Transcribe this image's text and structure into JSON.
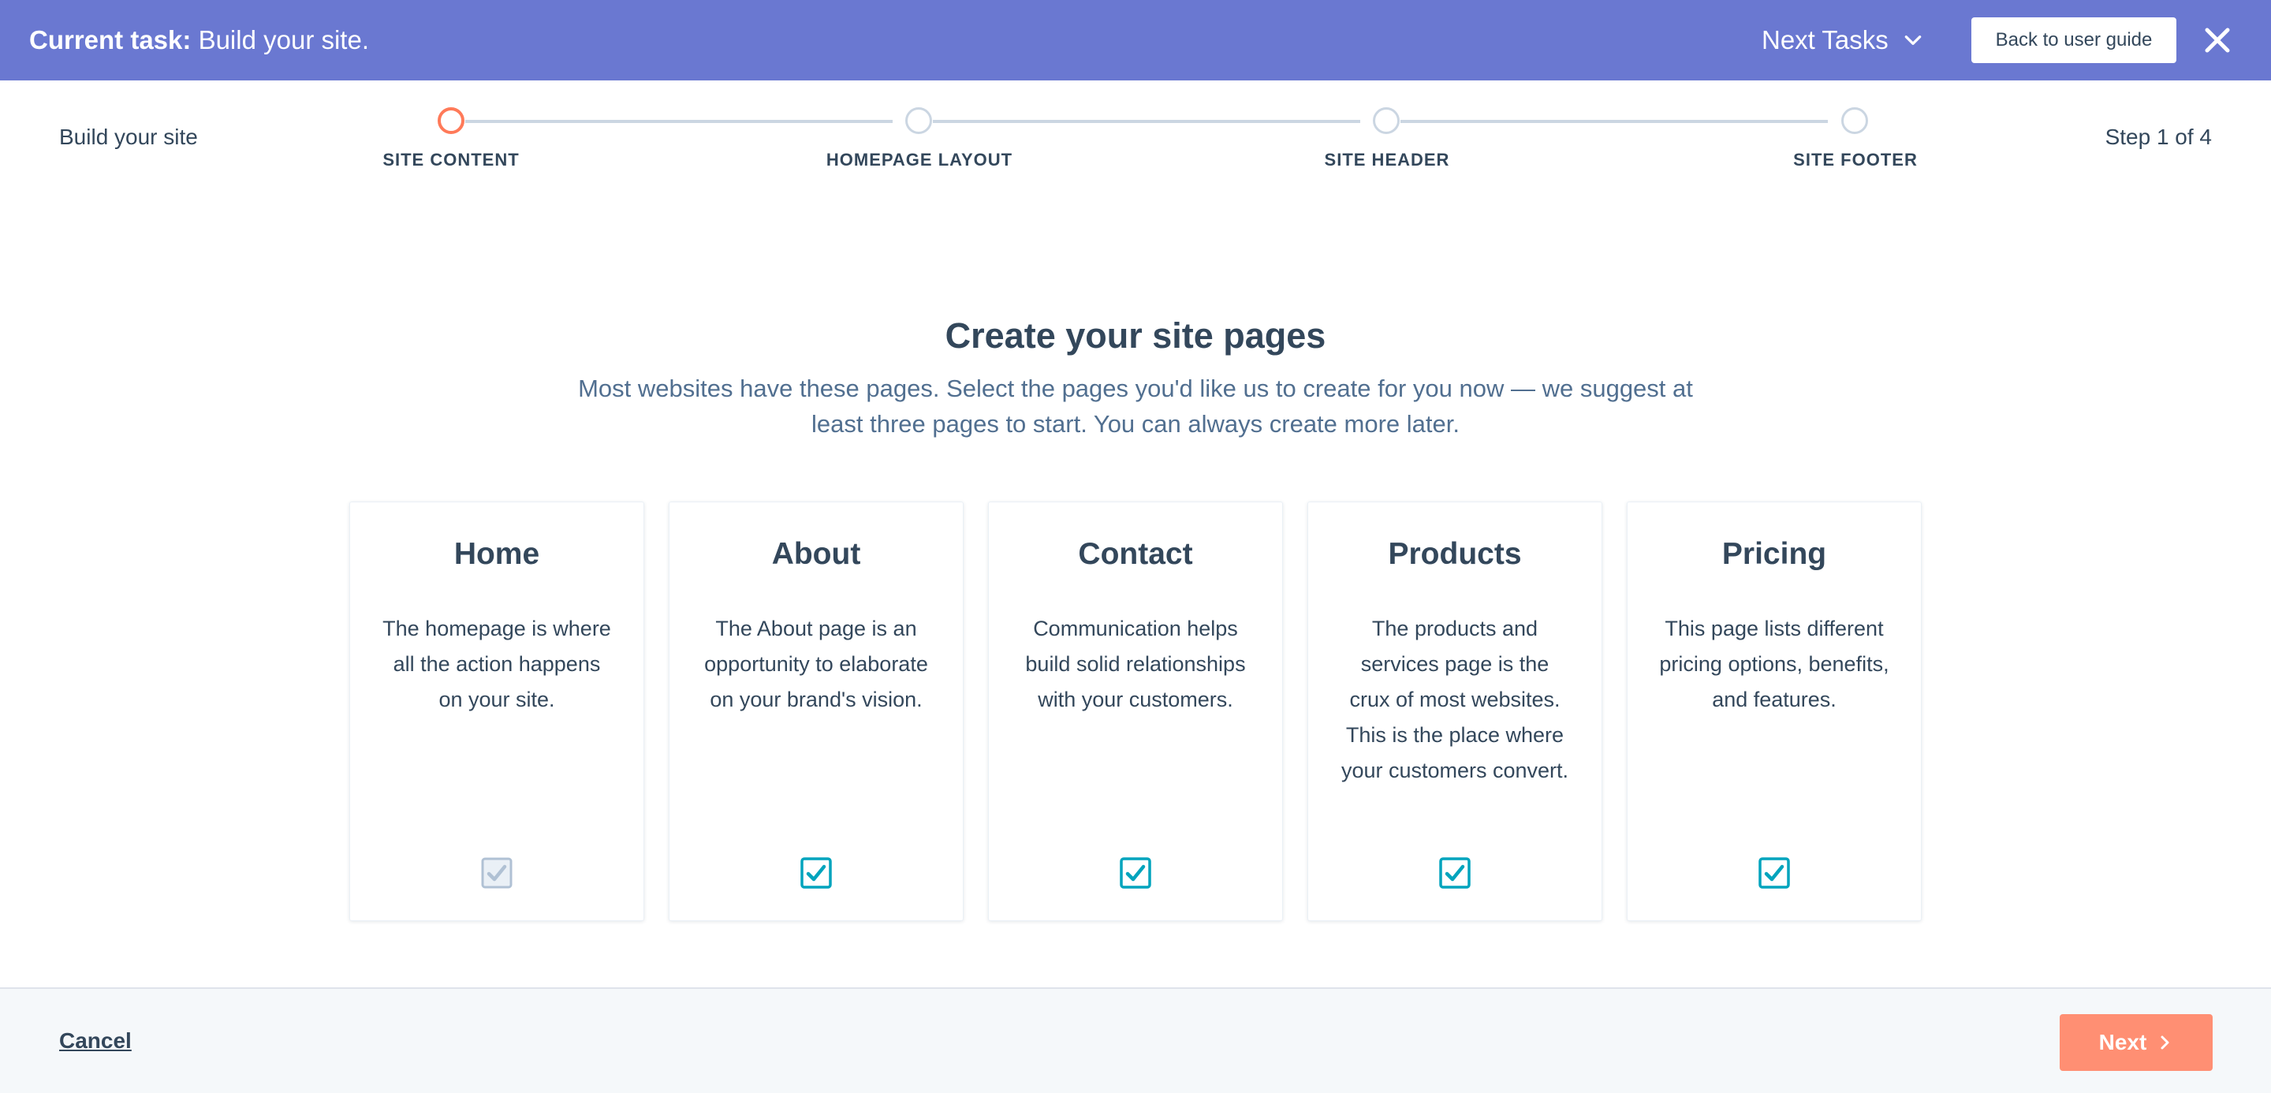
{
  "topbar": {
    "task_prefix": "Current task:",
    "task_name": "Build your site.",
    "next_tasks_label": "Next Tasks",
    "guide_button": "Back to user guide"
  },
  "stepper": {
    "title": "Build your site",
    "progress": "Step 1 of 4",
    "steps": [
      {
        "label": "SITE CONTENT",
        "active": true
      },
      {
        "label": "HOMEPAGE LAYOUT",
        "active": false
      },
      {
        "label": "SITE HEADER",
        "active": false
      },
      {
        "label": "SITE FOOTER",
        "active": false
      }
    ]
  },
  "main": {
    "heading": "Create your site pages",
    "subheading": "Most websites have these pages. Select the pages you'd like us to create for you now — we suggest at least three pages to start. You can always create more later."
  },
  "cards": [
    {
      "title": "Home",
      "description": "The homepage is where all the action happens on your site.",
      "checked": true,
      "disabled": true
    },
    {
      "title": "About",
      "description": "The About page is an opportunity to elaborate on your brand's vision.",
      "checked": true,
      "disabled": false
    },
    {
      "title": "Contact",
      "description": "Communication helps build solid relationships with your customers.",
      "checked": true,
      "disabled": false
    },
    {
      "title": "Products",
      "description": "The products and services page is the crux of most websites. This is the place where your customers convert.",
      "checked": true,
      "disabled": false
    },
    {
      "title": "Pricing",
      "description": "This page lists different pricing options, benefits, and features.",
      "checked": true,
      "disabled": false
    }
  ],
  "footer": {
    "cancel_label": "Cancel",
    "next_label": "Next"
  },
  "colors": {
    "topbar": "#6a78d1",
    "active_step": "#ff7a59",
    "checkbox": "#00a4bd",
    "checkbox_disabled": "#b0c1d4",
    "next_button": "#ff8f73"
  },
  "icons": {
    "next_tasks": "chevron-down-icon",
    "close": "close-icon",
    "checkbox": "checkbox-checked-icon",
    "next": "chevron-right-icon"
  }
}
